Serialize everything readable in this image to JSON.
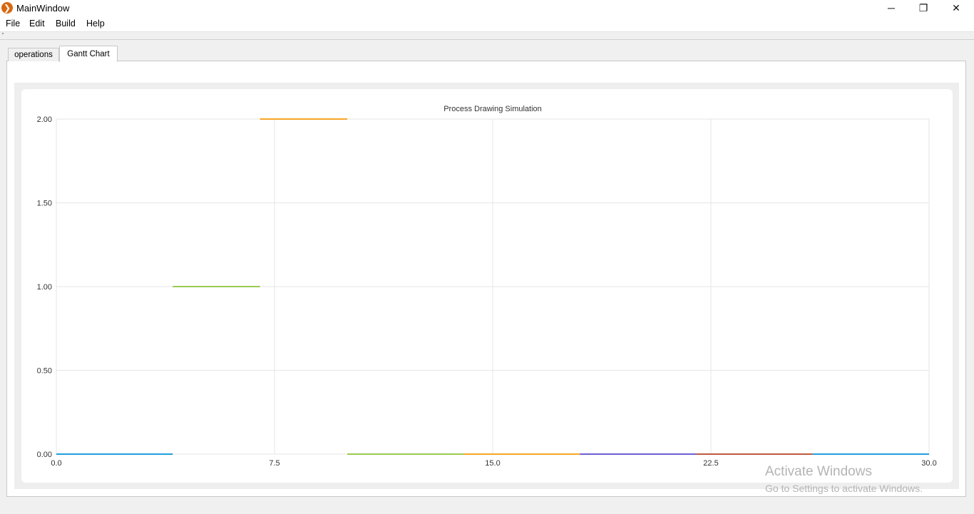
{
  "window": {
    "icon": "app-logo-icon",
    "title": "MainWindow",
    "controls": {
      "minimize": "─",
      "maximize": "❐",
      "close": "✕"
    }
  },
  "menu": [
    "File",
    "Edit",
    "Build",
    "Help"
  ],
  "tabs": [
    {
      "label": "operations",
      "active": false
    },
    {
      "label": "Gantt Chart",
      "active": true
    }
  ],
  "chart_data": {
    "type": "line",
    "title": "Process Drawing Simulation",
    "xlim": [
      0,
      30
    ],
    "ylim": [
      0,
      2
    ],
    "xticks": [
      "0.0",
      "7.5",
      "15.0",
      "22.5",
      "30.0"
    ],
    "yticks": [
      "0.00",
      "0.50",
      "1.00",
      "1.50",
      "2.00"
    ],
    "grid": true,
    "segments": [
      {
        "x": [
          0,
          4
        ],
        "y": 0,
        "color": "#209fdf"
      },
      {
        "x": [
          4,
          7
        ],
        "y": 1,
        "color": "#99ca53"
      },
      {
        "x": [
          7,
          10
        ],
        "y": 2,
        "color": "#f6a625"
      },
      {
        "x": [
          10,
          14
        ],
        "y": 0,
        "color": "#99ca53"
      },
      {
        "x": [
          14,
          18
        ],
        "y": 0,
        "color": "#f6a625"
      },
      {
        "x": [
          18,
          22
        ],
        "y": 0,
        "color": "#6d5fd5"
      },
      {
        "x": [
          22,
          26
        ],
        "y": 0,
        "color": "#bf593e"
      },
      {
        "x": [
          26,
          30
        ],
        "y": 0,
        "color": "#209fdf"
      }
    ]
  },
  "watermark": {
    "line1": "Activate Windows",
    "line2": "Go to Settings to activate Windows."
  }
}
